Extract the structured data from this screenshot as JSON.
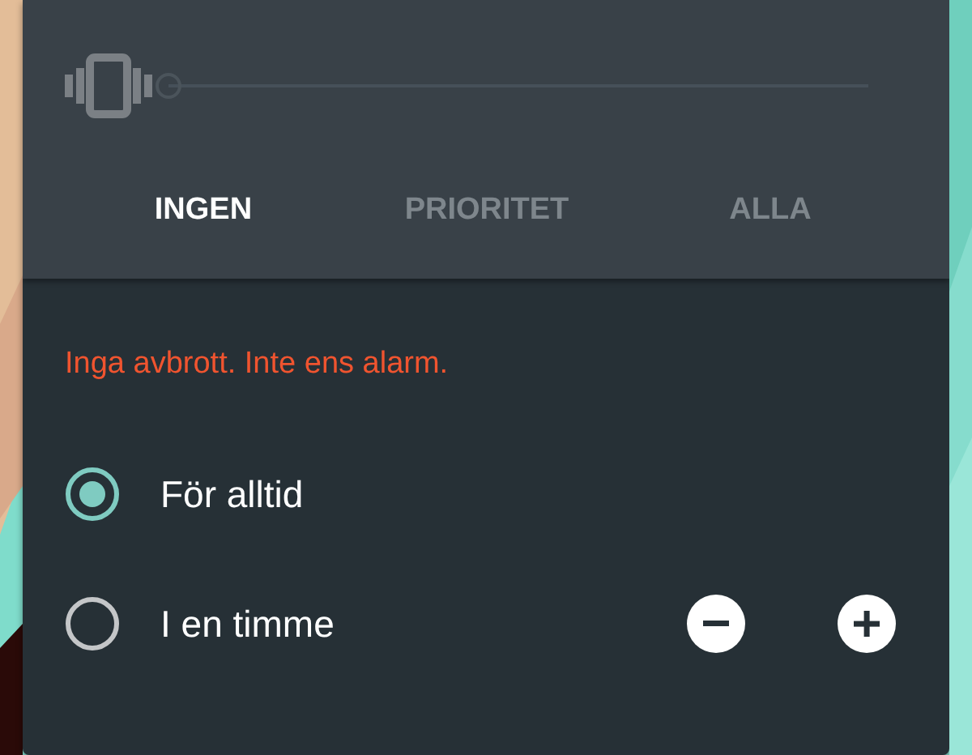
{
  "slider": {
    "level": 0
  },
  "tabs": [
    {
      "label": "INGEN",
      "selected": true
    },
    {
      "label": "PRIORITET",
      "selected": false
    },
    {
      "label": "ALLA",
      "selected": false
    }
  ],
  "message": "Inga avbrott. Inte ens alarm.",
  "options": [
    {
      "label": "För alltid",
      "selected": true,
      "stepper": false
    },
    {
      "label": "I en timme",
      "selected": false,
      "stepper": true
    }
  ]
}
